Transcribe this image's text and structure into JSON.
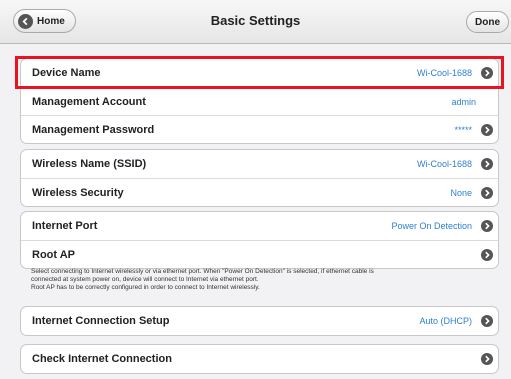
{
  "nav": {
    "title": "Basic Settings",
    "home_label": "Home",
    "done_label": "Done"
  },
  "groups": [
    {
      "rows": [
        {
          "label": "Device Name",
          "value": "Wi-Cool-1688",
          "arrow": true,
          "highlighted": true
        },
        {
          "label": "Management Account",
          "value": "admin",
          "arrow": false
        },
        {
          "label": "Management Password",
          "value": "*****",
          "arrow": true
        }
      ]
    },
    {
      "rows": [
        {
          "label": "Wireless Name (SSID)",
          "value": "Wi-Cool-1688",
          "arrow": true
        },
        {
          "label": "Wireless Security",
          "value": "None",
          "arrow": true
        }
      ]
    },
    {
      "rows": [
        {
          "label": "Internet Port",
          "value": "Power On Detection",
          "arrow": true
        },
        {
          "label": "Root AP",
          "value": "",
          "arrow": true
        }
      ]
    },
    {
      "rows": [
        {
          "label": "Internet Connection Setup",
          "value": "Auto (DHCP)",
          "arrow": true
        }
      ]
    },
    {
      "rows": [
        {
          "label": "Check Internet Connection",
          "value": "",
          "arrow": true
        }
      ]
    }
  ],
  "note": {
    "line1": "Select connecting to Internet wirelessly or via ethernet port. When \"Power On Detection\" is selected, if ethernet cable is",
    "line2": "connected at system power on, device will connect to Internet via ethernet port.",
    "line3": "Root AP has to be correctly configured in order to connect to Internet wirelessly."
  },
  "colors": {
    "value_text": "#2f80d1",
    "highlight_border": "#e8141f"
  }
}
